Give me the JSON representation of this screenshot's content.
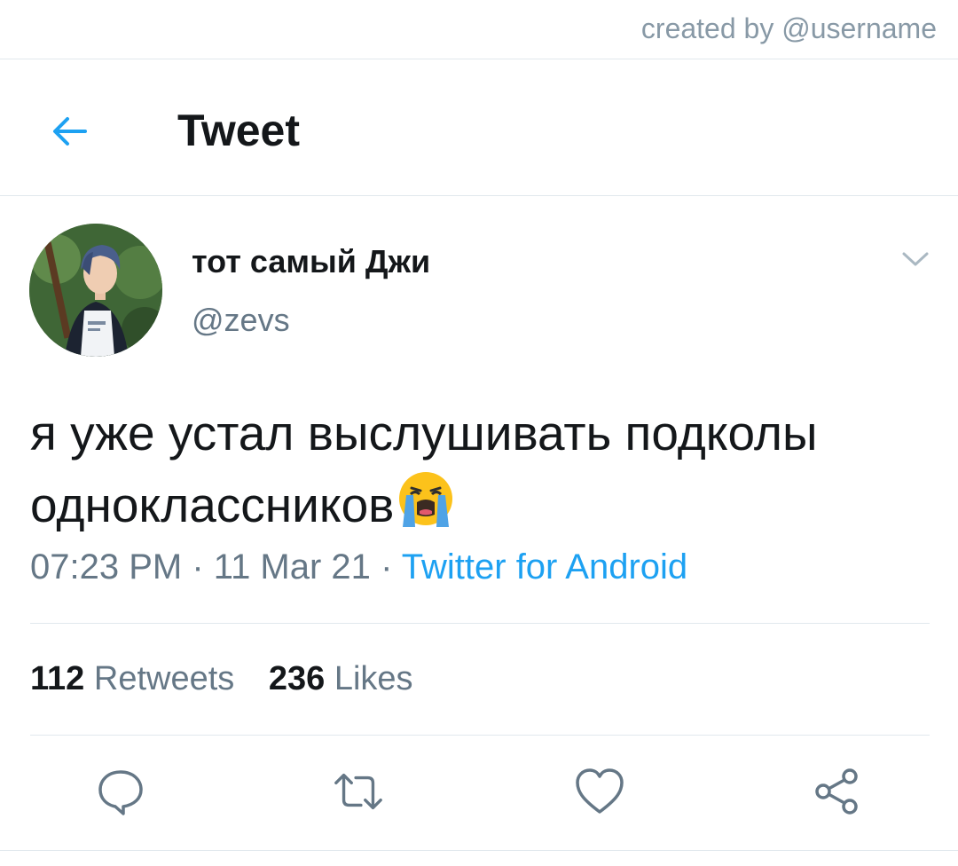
{
  "credit": "created by @username",
  "header": {
    "title": "Tweet",
    "back_icon": "arrow-left-icon"
  },
  "author": {
    "name": "тот самый Джи",
    "handle": "@zevs"
  },
  "tweet": {
    "text": "я уже устал выслушивать подколы одноклассников",
    "emoji": "loudly-crying-face-emoji",
    "time": "07:23 PM",
    "date": "11 Mar 21",
    "separator": "·",
    "source": "Twitter for Android"
  },
  "stats": {
    "retweets_count": "112",
    "retweets_label": "Retweets",
    "likes_count": "236",
    "likes_label": "Likes"
  },
  "actions": [
    "reply-icon",
    "retweet-icon",
    "like-icon",
    "share-icon"
  ],
  "colors": {
    "accent": "#1da1f2",
    "icon": "#657786",
    "text": "#14171a",
    "divider": "#e1e8ed"
  }
}
